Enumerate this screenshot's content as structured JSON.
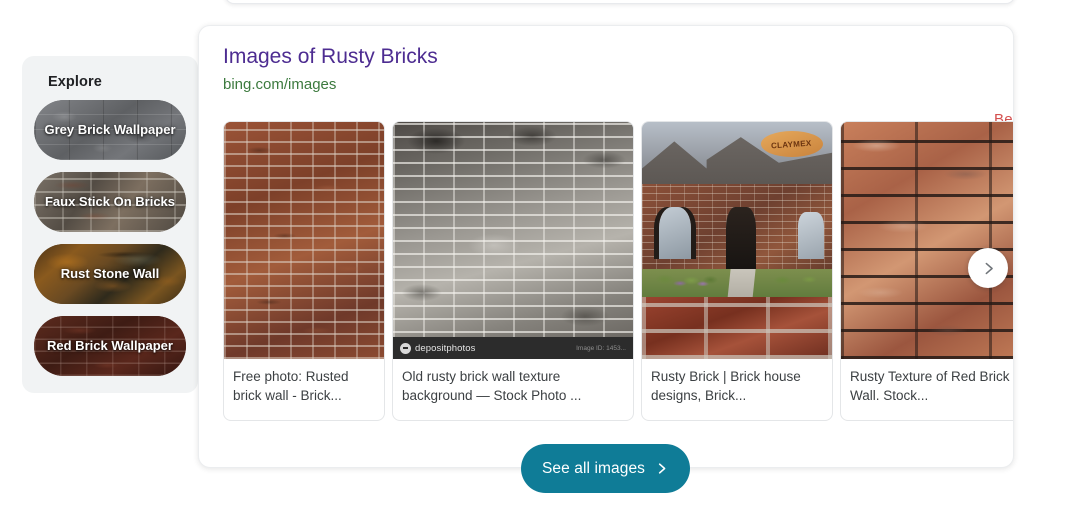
{
  "sidebar": {
    "title": "Explore",
    "items": [
      {
        "label": "Grey Brick Wallpaper",
        "texture": "grey-stone"
      },
      {
        "label": "Faux Stick On Bricks",
        "texture": "faux-brick"
      },
      {
        "label": "Rust Stone Wall",
        "texture": "rust-stone"
      },
      {
        "label": "Red Brick Wallpaper",
        "texture": "red-brick"
      }
    ]
  },
  "card": {
    "title": "Images of Rusty Bricks",
    "url": "bing.com/images",
    "annotation": "Before",
    "annotation_color": "#d4504e",
    "title_color": "#4d2c91",
    "url_color": "#3c7a3e"
  },
  "thumbnails": [
    {
      "caption": "Free photo: Rusted brick wall - Brick...",
      "alt": "Rusted red brick wall texture"
    },
    {
      "caption": "Old rusty brick wall texture background — Stock Photo ...",
      "alt": "Old grey weathered brick wall",
      "watermark": "depositphotos",
      "watermark_id": "Image ID: 1453..."
    },
    {
      "caption": "Rusty Brick | Brick house designs, Brick...",
      "alt": "Brick house exterior with brick wall foreground",
      "logo": "CLAYMEX"
    },
    {
      "caption": "Rusty Texture of Red Brick Wall. Stock...",
      "alt": "Salmon terracotta brick wall rows"
    }
  ],
  "controls": {
    "next_arrow": "chevron-right-icon",
    "see_all_label": "See all images",
    "see_all_icon": "chevron-right-icon",
    "see_all_color": "#0f7c97"
  }
}
